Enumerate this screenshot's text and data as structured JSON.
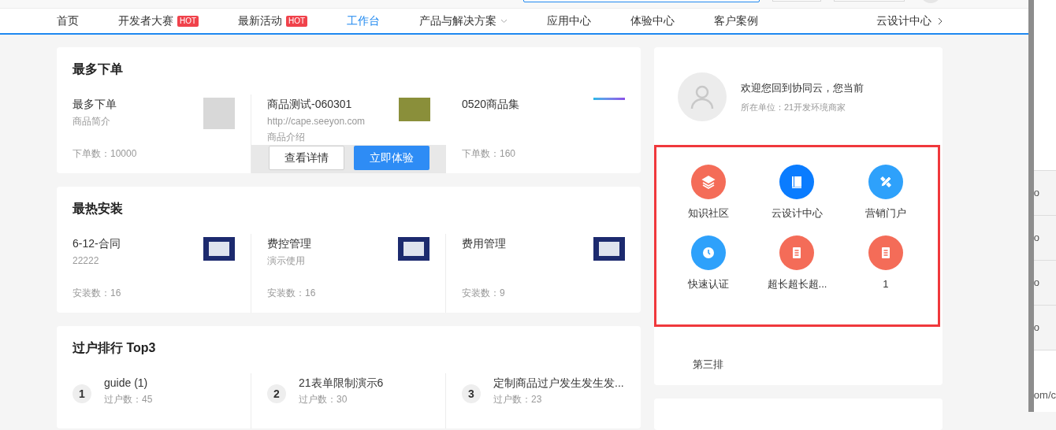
{
  "nav": {
    "items": [
      {
        "label": "首页",
        "selected": false,
        "kind": "link"
      },
      {
        "label": "开发者大赛",
        "selected": false,
        "kind": "link",
        "badge": "HOT"
      },
      {
        "label": "最新活动",
        "selected": false,
        "kind": "link",
        "badge": "HOT"
      },
      {
        "label": "工作台",
        "selected": true,
        "kind": "link"
      },
      {
        "label": "产品与解决方案",
        "selected": false,
        "kind": "dropdown"
      },
      {
        "label": "应用中心",
        "selected": false,
        "kind": "link"
      },
      {
        "label": "体验中心",
        "selected": false,
        "kind": "link"
      },
      {
        "label": "客户案例",
        "selected": false,
        "kind": "link"
      }
    ],
    "right_link": "云设计中心"
  },
  "sections": [
    {
      "title": "最多下单",
      "kind": "order",
      "items": [
        {
          "name": "最多下单",
          "desc": "商品简介",
          "meta": "下单数：10000",
          "kind": "blank"
        },
        {
          "name": "商品测试-060301",
          "url": "http://cape.seeyon.com",
          "desc": "商品介绍",
          "kind": "photo",
          "hovered": true,
          "actions": [
            "查看详情",
            "立即体验"
          ]
        },
        {
          "name": "0520商品集",
          "meta": "下单数：160",
          "kind": "gradient"
        }
      ]
    },
    {
      "title": "最热安装",
      "kind": "install",
      "items": [
        {
          "name": "6-12-合同",
          "desc": "22222",
          "meta": "安装数：16",
          "kind": "screenshot"
        },
        {
          "name": "费控管理",
          "desc": "演示使用",
          "meta": "安装数：16",
          "kind": "screenshot"
        },
        {
          "name": "费用管理",
          "meta": "安装数：9",
          "kind": "screenshot"
        }
      ]
    },
    {
      "title": "过户排行 Top3",
      "kind": "rank",
      "items": [
        {
          "rank": "1",
          "name": "guide (1)",
          "meta": "过户数：45"
        },
        {
          "rank": "2",
          "name": "21表单限制演示6",
          "meta": "过户数：30"
        },
        {
          "rank": "3",
          "name": "定制商品过户发生发生发...",
          "meta": "过户数：23"
        }
      ]
    }
  ],
  "profile": {
    "welcome": "欢迎您回到协同云，您当前",
    "unit": "所在单位：21开发环境商家"
  },
  "quick_links": [
    {
      "label": "知识社区",
      "kind": "layers",
      "color": "#f46c58"
    },
    {
      "label": "云设计中心",
      "kind": "book",
      "color": "#0a7cff"
    },
    {
      "label": "营销门户",
      "kind": "tools",
      "color": "#2ea1fb"
    },
    {
      "label": "快速认证",
      "kind": "clock",
      "color": "#2ea1fb"
    },
    {
      "label": "超长超长超...",
      "kind": "doc",
      "color": "#f46c58"
    },
    {
      "label": "1",
      "kind": "doc",
      "color": "#f46c58"
    }
  ],
  "third_row": "第三排",
  "side_window": {
    "rows": [
      "o",
      "o",
      "o",
      "o"
    ],
    "footer": "om/c"
  }
}
